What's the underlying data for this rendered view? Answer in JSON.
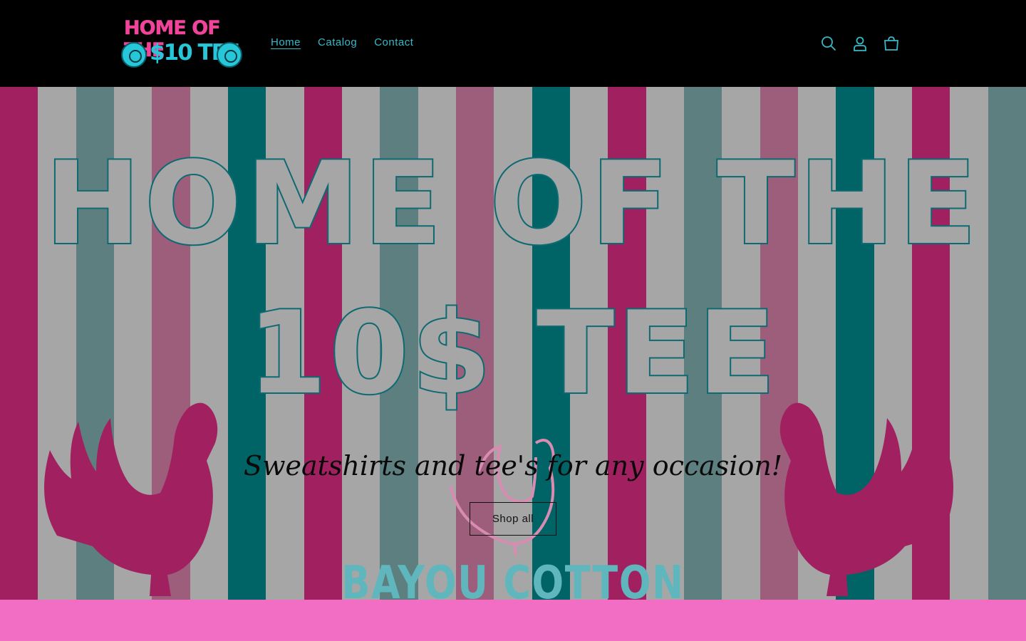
{
  "header": {
    "logo": {
      "line1": "HOME OF THE",
      "line2": "$10 TEE"
    },
    "nav": [
      {
        "label": "Home",
        "active": true
      },
      {
        "label": "Catalog",
        "active": false
      },
      {
        "label": "Contact",
        "active": false
      }
    ],
    "icons": [
      "search-icon",
      "account-icon",
      "cart-icon"
    ]
  },
  "hero": {
    "title_line1": "HOME OF THE",
    "title_line2": "10$ TEE",
    "tagline": "Sweatshirts and tee's for any occasion!",
    "button_label": "Shop all",
    "brand_text": "BAYOU COTTON"
  },
  "colors": {
    "header_bg": "#000000",
    "nav_text": "#36b9c6",
    "logo_pink": "#f0449a",
    "logo_teal": "#25c7d8",
    "stripe_magenta": "#a12160",
    "stripe_teal": "#006466",
    "stripe_gray": "#a6a6a6",
    "stripe_rose": "#9c5e7a",
    "stripe_slate": "#5e7f7f",
    "band_pink": "#f26ec5"
  }
}
